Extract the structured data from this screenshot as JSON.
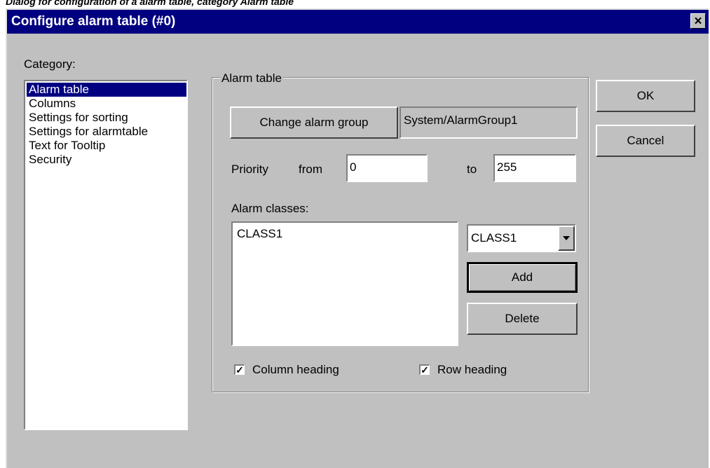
{
  "caption": "Dialog for configuration of a alarm table, category Alarm table",
  "window": {
    "title": "Configure alarm table (#0)",
    "close_glyph": "×"
  },
  "category": {
    "label": "Category:",
    "items": [
      {
        "label": "Alarm table",
        "selected": true
      },
      {
        "label": "Columns",
        "selected": false
      },
      {
        "label": "Settings for sorting",
        "selected": false
      },
      {
        "label": "Settings for alarmtable",
        "selected": false
      },
      {
        "label": "Text for Tooltip",
        "selected": false
      },
      {
        "label": "Security",
        "selected": false
      }
    ]
  },
  "group": {
    "label": "Alarm table",
    "change_group_button": "Change alarm group",
    "alarm_group_value": "System/AlarmGroup1",
    "priority_label": "Priority",
    "from_label": "from",
    "from_value": "0",
    "to_label": "to",
    "to_value": "255",
    "classes_label": "Alarm classes:",
    "classes_list": [
      "CLASS1"
    ],
    "class_select_value": "CLASS1",
    "add_button": "Add",
    "delete_button": "Delete",
    "column_heading_label": "Column heading",
    "column_heading_checked": true,
    "row_heading_label": "Row heading",
    "row_heading_checked": true
  },
  "buttons": {
    "ok": "OK",
    "cancel": "Cancel"
  },
  "colors": {
    "titlebar": "#000080",
    "dialog_bg": "#c0c0c0",
    "selection": "#000080"
  }
}
